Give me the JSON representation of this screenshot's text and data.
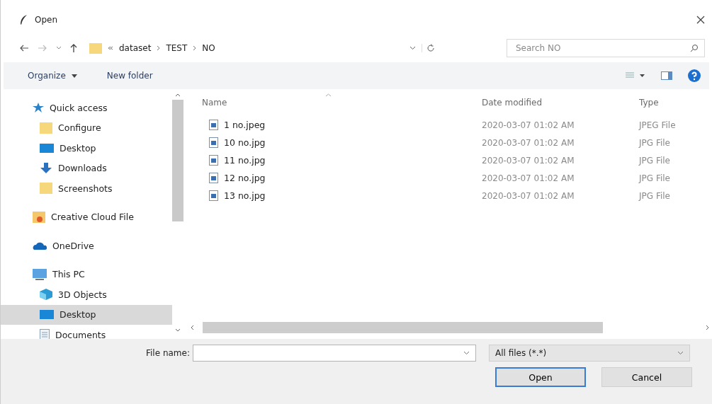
{
  "window": {
    "title": "Open"
  },
  "address": {
    "path": [
      "dataset",
      "TEST",
      "NO"
    ]
  },
  "search": {
    "placeholder": "Search NO"
  },
  "toolbar": {
    "organize": "Organize",
    "new_folder": "New folder"
  },
  "sidebar": {
    "items": [
      {
        "label": "Quick access",
        "kind": "quick",
        "selected": false,
        "children": [
          {
            "label": "Configure",
            "kind": "folder",
            "selected": false
          },
          {
            "label": "Desktop",
            "kind": "desktop",
            "selected": false
          },
          {
            "label": "Downloads",
            "kind": "download",
            "selected": false
          },
          {
            "label": "Screenshots",
            "kind": "folder",
            "selected": false
          }
        ]
      },
      {
        "label": "Creative Cloud File",
        "kind": "cc",
        "selected": false
      },
      {
        "label": "OneDrive",
        "kind": "cloud",
        "selected": false
      },
      {
        "label": "This PC",
        "kind": "pc",
        "selected": false,
        "children": [
          {
            "label": "3D Objects",
            "kind": "cube",
            "selected": false
          },
          {
            "label": "Desktop",
            "kind": "desktop",
            "selected": true
          },
          {
            "label": "Documents",
            "kind": "doc",
            "selected": false
          }
        ]
      }
    ]
  },
  "table": {
    "columns": [
      "Name",
      "Date modified",
      "Type"
    ],
    "rows": [
      {
        "name": "1 no.jpeg",
        "date": "2020-03-07 01:02 AM",
        "type": "JPEG File"
      },
      {
        "name": "10 no.jpg",
        "date": "2020-03-07 01:02 AM",
        "type": "JPG File"
      },
      {
        "name": "11 no.jpg",
        "date": "2020-03-07 01:02 AM",
        "type": "JPG File"
      },
      {
        "name": "12 no.jpg",
        "date": "2020-03-07 01:02 AM",
        "type": "JPG File"
      },
      {
        "name": "13 no.jpg",
        "date": "2020-03-07 01:02 AM",
        "type": "JPG File"
      }
    ]
  },
  "file_name": {
    "label": "File name:"
  },
  "file_type": {
    "value": "All files (*.*)"
  },
  "buttons": [
    {
      "label": "Open",
      "default": true
    },
    {
      "label": "Cancel",
      "default": false
    }
  ]
}
